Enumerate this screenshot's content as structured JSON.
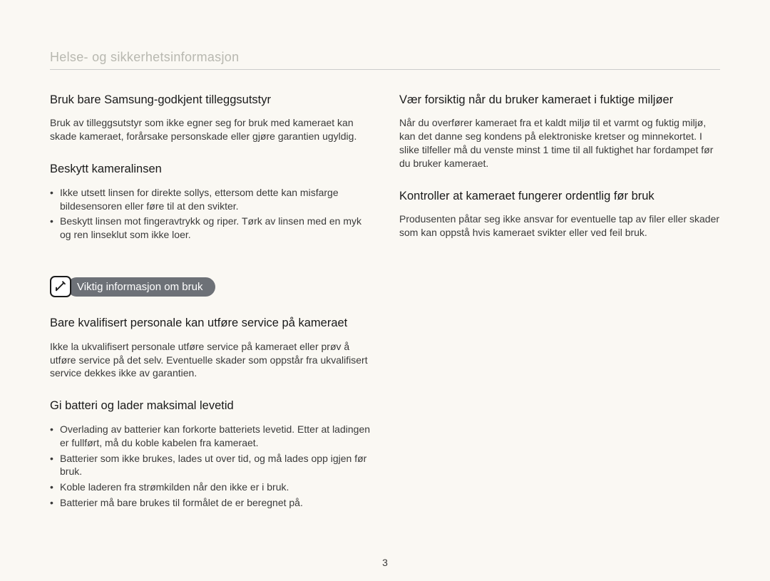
{
  "breadcrumb": "Helse- og sikkerhetsinformasjon",
  "pageNumber": "3",
  "left": {
    "sec1": {
      "heading": "Bruk bare Samsung-godkjent tilleggsutstyr",
      "body": "Bruk av tilleggsutstyr som ikke egner seg for bruk med kameraet kan skade kameraet, forårsake personskade eller gjøre garantien ugyldig."
    },
    "sec2": {
      "heading": "Beskytt kameralinsen",
      "bullets": [
        "Ikke utsett linsen for direkte sollys, ettersom dette kan misfarge bildesensoren eller føre til at den svikter.",
        "Beskytt linsen mot fingeravtrykk og riper. Tørk av linsen med en myk og ren linseklut som ikke loer."
      ]
    },
    "pill": "Viktig informasjon om bruk",
    "sec3": {
      "heading": "Bare kvalifisert personale kan utføre service på kameraet",
      "body": "Ikke la ukvalifisert personale utføre service på kameraet eller prøv å utføre service på det selv. Eventuelle skader som oppstår fra ukvalifisert service dekkes ikke av garantien."
    },
    "sec4": {
      "heading": "Gi batteri og lader maksimal levetid",
      "bullets": [
        "Overlading av batterier kan forkorte batteriets levetid. Etter at ladingen er fullført, må du koble kabelen fra kameraet.",
        "Batterier som ikke brukes, lades ut over tid, og må lades opp igjen før bruk.",
        "Koble laderen fra strømkilden når den ikke er i bruk.",
        "Batterier må bare brukes til formålet de er beregnet på."
      ]
    }
  },
  "right": {
    "sec1": {
      "heading": "Vær forsiktig når du bruker kameraet i fuktige miljøer",
      "body": "Når du overfører kameraet fra et kaldt miljø til et varmt og fuktig miljø, kan det danne seg kondens på elektroniske kretser og minnekortet. I slike tilfeller må du venste minst 1 time til all fuktighet har fordampet før du bruker kameraet."
    },
    "sec2": {
      "heading": "Kontroller at kameraet fungerer ordentlig før bruk",
      "body": "Produsenten påtar seg ikke ansvar for eventuelle tap av filer eller skader som kan oppstå hvis kameraet svikter eller ved feil bruk."
    }
  }
}
